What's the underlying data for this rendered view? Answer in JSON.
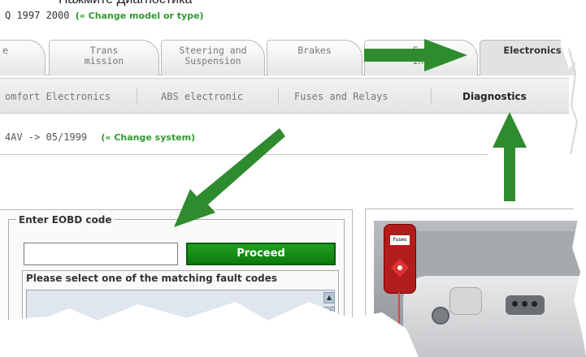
{
  "caption": "Нажмите Диагностика",
  "model_line": {
    "text": "Q 1997 2000",
    "link": "(« Change model or type)"
  },
  "tabs": [
    {
      "label": "e",
      "active": false
    },
    {
      "label": "Trans\nmission",
      "active": false
    },
    {
      "label": "Steering and\nSuspension",
      "active": false
    },
    {
      "label": "Brakes",
      "active": false
    },
    {
      "label": "Ext\nInt",
      "active": false
    },
    {
      "label": "Electronics",
      "active": true
    }
  ],
  "subtabs": [
    {
      "label": "omfort Electronics",
      "active": false
    },
    {
      "label": "ABS electronic",
      "active": false
    },
    {
      "label": "Fuses and Relays",
      "active": false
    },
    {
      "label": "Diagnostics",
      "active": true
    }
  ],
  "system_line": {
    "text": "4AV -> 05/1999",
    "link": "(« Change system)"
  },
  "eobd": {
    "legend": "Enter EOBD code",
    "input_value": "",
    "button_label": "Proceed",
    "fault_title": "Please select one of the matching fault codes"
  },
  "right_panel": {
    "fuse_label": "Fuses"
  },
  "colors": {
    "accent_green": "#2f9a2f",
    "button_green": "#129012",
    "arrow_green": "#2e8b2e",
    "fuse_red": "#b11c1c"
  },
  "icons": [
    "arrow-right-icon",
    "arrow-down-left-icon",
    "arrow-up-icon",
    "scroll-up-icon",
    "scroll-down-icon",
    "scroll-left-icon"
  ]
}
